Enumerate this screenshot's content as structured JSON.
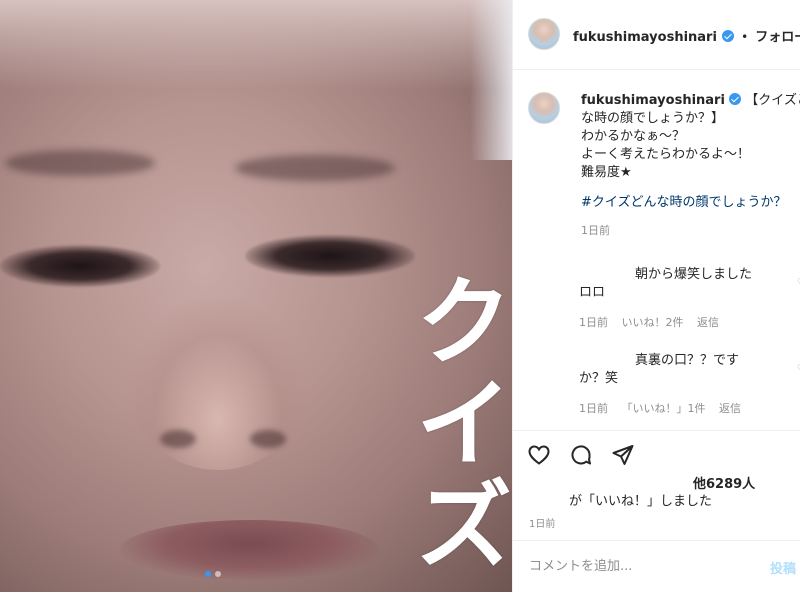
{
  "post": {
    "image_text": "クイズ",
    "carousel": {
      "total": 2,
      "active": 1
    }
  },
  "header": {
    "username": "fukushimayoshinari",
    "separator": "•",
    "follow_label": "フォロー中"
  },
  "caption": {
    "username": "fukushimayoshinari",
    "line1": "【クイズどん",
    "line2": "な時の顔でしょうか？】",
    "line3": "わかるかなぁ～？",
    "line4": "よーく考えたらわかるよ～！",
    "line5": "難易度★",
    "hashtag": "#クイズどんな時の顔でしょうか？",
    "time": "1日前"
  },
  "comments": [
    {
      "line1": "朝から爆笑しました",
      "line2": "ロロ",
      "time": "1日前",
      "likes": "いいね！2件",
      "reply": "返信"
    },
    {
      "line1": "真裏の口？？です",
      "line2": "か？笑",
      "time": "1日前",
      "likes": "「いいね！」1件",
      "reply": "返信"
    }
  ],
  "likes": {
    "count": "他6289人",
    "text": "が「いいね！」しました"
  },
  "date": "1日前",
  "comment_input": {
    "placeholder": "コメントを追加...",
    "post_label": "投稿"
  },
  "colors": {
    "link": "#00376b",
    "verified": "#3897f0",
    "muted": "#8e8e8e",
    "post_disabled": "#b2dffc"
  }
}
